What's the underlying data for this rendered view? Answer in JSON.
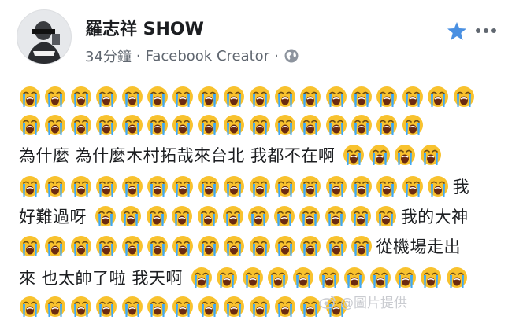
{
  "post": {
    "author": "羅志祥 SHOW",
    "time": "34分鐘",
    "separator": "·",
    "source": "Facebook Creator",
    "separator2": "·"
  },
  "icons": {
    "avatar": "profile-photo",
    "globe": "globe-icon",
    "star": "star-icon",
    "more": "more-dots-icon",
    "emoji": "loudly-crying-face-emoji"
  },
  "colors": {
    "star": "#4a90e2",
    "emoji_face": "#f8c22e",
    "emoji_tears": "#3fa9f5",
    "muted_text": "#606770"
  },
  "lines": [
    {
      "emoji_before": 18,
      "text": "",
      "emoji_after": 0
    },
    {
      "emoji_before": 16,
      "text": "",
      "emoji_after": 0
    },
    {
      "emoji_before": 0,
      "text": "為什麼 為什麼木村拓哉來台北 我都不在啊",
      "emoji_after": 4
    },
    {
      "emoji_before": 17,
      "text": "我",
      "emoji_after": 0
    },
    {
      "emoji_before": 0,
      "text": "好難過呀",
      "emoji_after": 12,
      "text_after": "我的大神"
    },
    {
      "emoji_before": 14,
      "text": "從機場走出",
      "emoji_after": 0
    },
    {
      "emoji_before": 0,
      "text": "來 也太帥了啦 我天啊",
      "emoji_after": 11
    },
    {
      "emoji_before": 13,
      "text": "",
      "emoji_after": 0
    }
  ],
  "watermark": "@圖片提供"
}
